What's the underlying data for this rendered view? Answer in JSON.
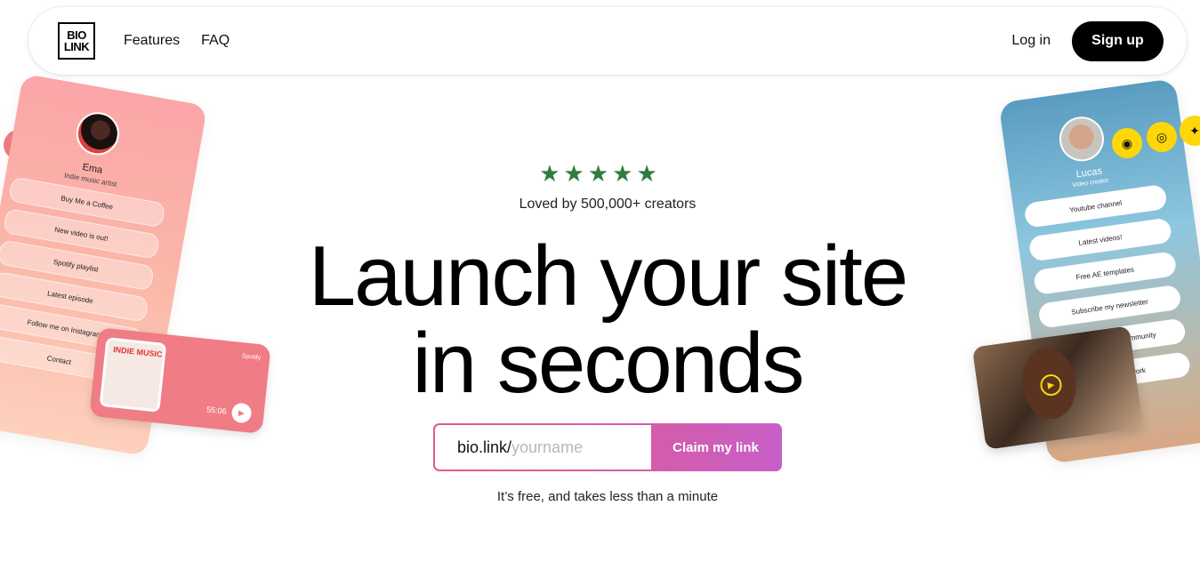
{
  "nav": {
    "logo_line1": "BIO",
    "logo_line2": "LINK",
    "links": [
      {
        "label": "Features"
      },
      {
        "label": "FAQ"
      }
    ],
    "login_label": "Log in",
    "signup_label": "Sign up"
  },
  "hero": {
    "stars": "★★★★★",
    "rating": 5,
    "loved_text": "Loved by 500,000+ creators",
    "headline_line1": "Launch your site",
    "headline_line2": "in seconds",
    "claim_prefix": "bio.link/",
    "claim_placeholder": "yourname",
    "claim_button": "Claim my link",
    "free_note": "It’s free, and takes less than a minute"
  },
  "left_mockup": {
    "name": "Ema",
    "subtitle": "Indie music artist",
    "links": [
      "Buy Me a Coffee",
      "New video is out!",
      "Spotify playlist",
      "Latest episode",
      "Follow me on Instagram",
      "Contact"
    ],
    "social_icons": [
      "instagram-icon",
      "twitter-icon"
    ],
    "music": {
      "cover_title": "INDIE MUSIC",
      "source": "Spotify",
      "time": "55:06"
    }
  },
  "right_mockup": {
    "name": "Lucas",
    "subtitle": "Video creator",
    "links": [
      "Youtube channel",
      "Latest videos!",
      "Free AE templates",
      "Subscribe my newsletter",
      "Join my design community",
      "Support my work"
    ],
    "social_icons": [
      "spotify-icon",
      "instagram-icon",
      "twitter-icon"
    ]
  },
  "colors": {
    "star_green": "#2e7d3e",
    "claim_gradient_start": "#e75a7c",
    "claim_gradient_end": "#c85ec8",
    "signup_bg": "#000000",
    "left_social": "#f07c86",
    "right_social": "#ffd60a"
  }
}
